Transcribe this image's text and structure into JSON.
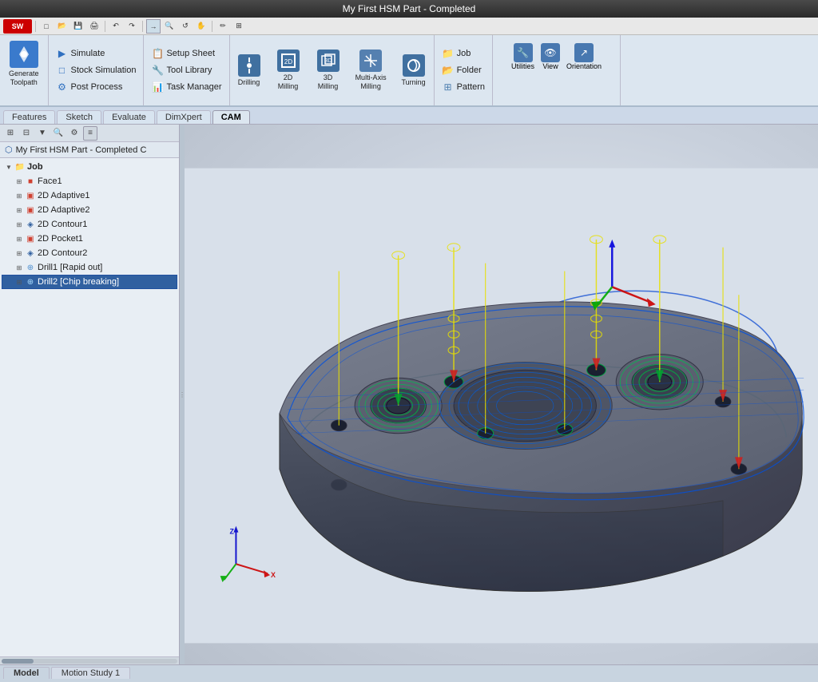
{
  "titlebar": {
    "title": "My First HSM Part - Completed"
  },
  "toolbar": {
    "buttons": [
      "□",
      "↩",
      "⟳",
      "⊞",
      "✂",
      "↶",
      "↷",
      "↺",
      "→",
      "□",
      "○",
      "△",
      "▷",
      "⊡",
      "⊠",
      "⊟",
      "⊞",
      "✎",
      "⊕"
    ]
  },
  "ribbon": {
    "sections": [
      {
        "id": "generate",
        "big_btn": {
          "label": "Generate\nToolpath",
          "icon": "⚙"
        }
      },
      {
        "id": "cam-actions",
        "small_btns": [
          {
            "label": "Simulate",
            "icon": "▶"
          },
          {
            "label": "Stock Simulation",
            "icon": "□"
          },
          {
            "label": "Post Process",
            "icon": "⚙"
          }
        ]
      },
      {
        "id": "setup",
        "small_btns": [
          {
            "label": "Setup Sheet",
            "icon": "📋"
          },
          {
            "label": "Tool Library",
            "icon": "🔧"
          },
          {
            "label": "Task Manager",
            "icon": "📊"
          }
        ]
      },
      {
        "id": "drilling",
        "label": "Drilling",
        "icon": "⬤"
      },
      {
        "id": "2d-milling",
        "label": "2D\nMilling",
        "icon": "◫"
      },
      {
        "id": "3d-milling",
        "label": "3D\nMilling",
        "icon": "◪"
      },
      {
        "id": "multi-axis",
        "label": "Multi-Axis\nMilling",
        "icon": "⊞"
      },
      {
        "id": "turning",
        "label": "Turning",
        "icon": "↻"
      },
      {
        "id": "job",
        "small_btns": [
          {
            "label": "Job",
            "icon": "📁"
          },
          {
            "label": "Folder",
            "icon": "📂"
          },
          {
            "label": "Pattern",
            "icon": "⊞"
          }
        ]
      },
      {
        "id": "view-tools",
        "small_btns": [
          {
            "label": "Utilities",
            "icon": "🔨"
          },
          {
            "label": "View",
            "icon": "👁"
          },
          {
            "label": "Orientation",
            "icon": "↗"
          }
        ]
      }
    ]
  },
  "tabs": {
    "items": [
      "Features",
      "Sketch",
      "Evaluate",
      "DimXpert",
      "CAM"
    ],
    "active": "CAM"
  },
  "panel": {
    "title": "My First HSM Part - Completed C",
    "tools": [
      "⊞",
      "⊟",
      "⊠",
      "⊡",
      "✎",
      "▼"
    ],
    "tree": {
      "root": "Job",
      "items": [
        {
          "id": "face1",
          "label": "Face1",
          "level": 1,
          "selected": false
        },
        {
          "id": "adaptive1",
          "label": "2D Adaptive1",
          "level": 1,
          "selected": false
        },
        {
          "id": "adaptive2",
          "label": "2D Adaptive2",
          "level": 1,
          "selected": false
        },
        {
          "id": "contour1",
          "label": "2D Contour1",
          "level": 1,
          "selected": false
        },
        {
          "id": "pocket1",
          "label": "2D Pocket1",
          "level": 1,
          "selected": false
        },
        {
          "id": "contour2",
          "label": "2D Contour2",
          "level": 1,
          "selected": false
        },
        {
          "id": "drill1",
          "label": "Drill1 [Rapid out]",
          "level": 1,
          "selected": false
        },
        {
          "id": "drill2",
          "label": "Drill2 [Chip breaking]",
          "level": 1,
          "selected": true
        }
      ]
    }
  },
  "viewport": {
    "toolbar_btns": [
      "🔍",
      "+",
      "-",
      "↔",
      "⊡",
      "⊞",
      "◫",
      "▣",
      "⊟",
      "↺",
      "↻",
      "⊕",
      "⬤",
      "✦",
      "⊿",
      "◈",
      "✱",
      "◉",
      "⟳"
    ]
  },
  "bottom_tabs": {
    "items": [
      "Model",
      "Motion Study 1"
    ],
    "active": "Model"
  },
  "solidworks_logo": "SW",
  "colors": {
    "accent_blue": "#3060a0",
    "ribbon_bg": "#dce6f0",
    "toolbar_bg": "#e8e8e8",
    "panel_bg": "#e8eef4",
    "part_color": "#5a6070",
    "toolpath_yellow": "#e8e000",
    "toolpath_blue": "#0050e0",
    "toolpath_green": "#00a040"
  }
}
